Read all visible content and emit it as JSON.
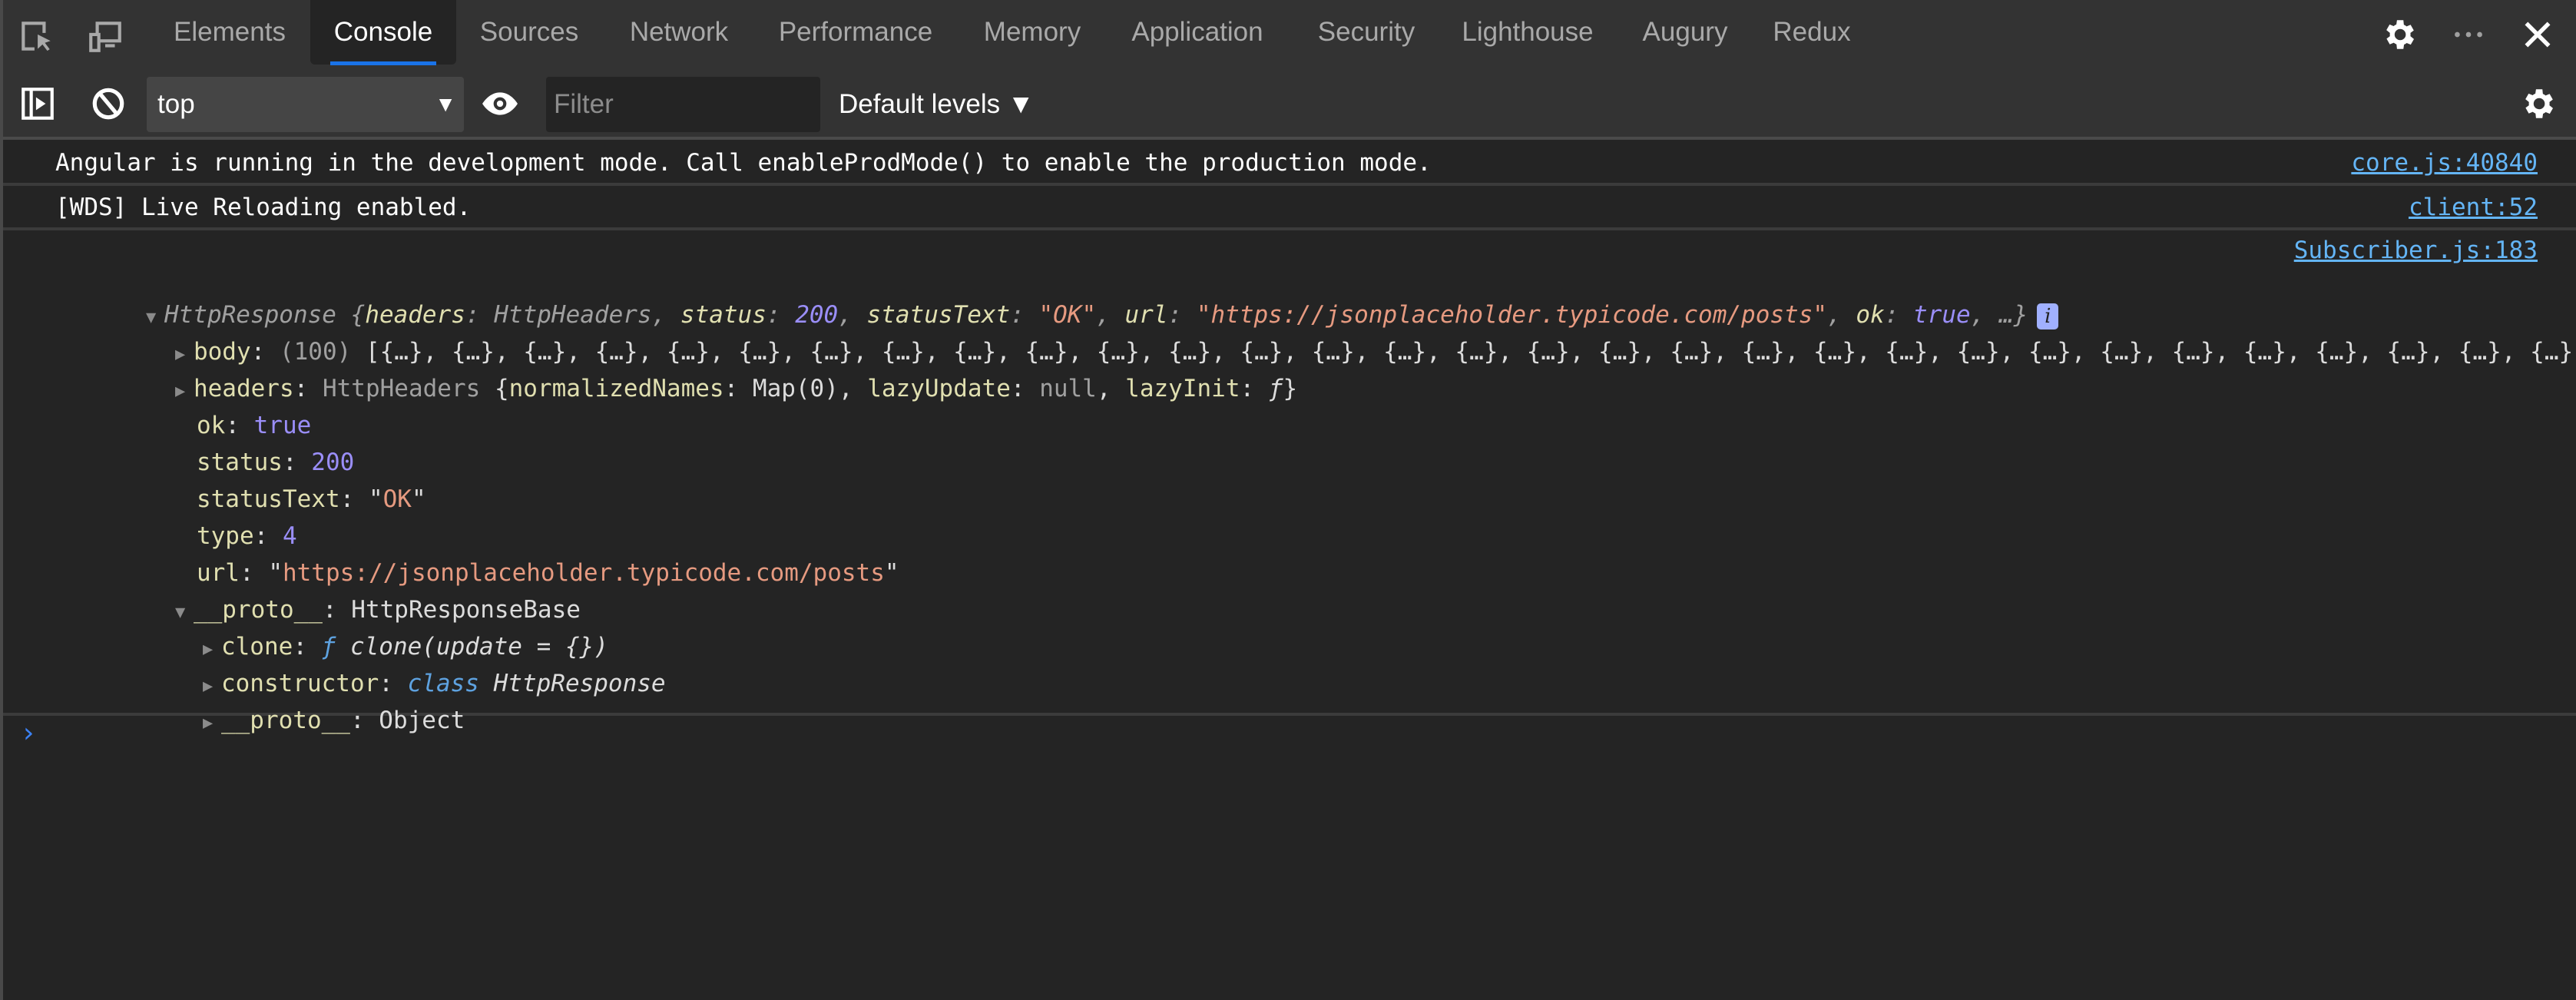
{
  "tabs": [
    {
      "label": "Elements",
      "active": false
    },
    {
      "label": "Console",
      "active": true
    },
    {
      "label": "Sources",
      "active": false
    },
    {
      "label": "Network",
      "active": false
    },
    {
      "label": "Performance",
      "active": false
    },
    {
      "label": "Memory",
      "active": false
    },
    {
      "label": "Application",
      "active": false
    },
    {
      "label": "Security",
      "active": false
    },
    {
      "label": "Lighthouse",
      "active": false
    },
    {
      "label": "Augury",
      "active": false
    },
    {
      "label": "Redux",
      "active": false
    }
  ],
  "toolbar": {
    "context_value": "top",
    "context_arrow": "▼",
    "filter_placeholder": "Filter",
    "filter_value": "",
    "levels_label": "Default levels ▼"
  },
  "messages": [
    {
      "text": "Angular is running in the development mode. Call enableProdMode() to enable the production mode.",
      "source": "core.js:40840"
    },
    {
      "text": "[WDS] Live Reloading enabled.",
      "source": "client:52"
    }
  ],
  "log": {
    "source": "Subscriber.js:183",
    "summary": {
      "class": "HttpResponse",
      "open": " {",
      "headers_key": "headers",
      "headers_val": "HttpHeaders",
      "status_key": "status",
      "status_val": "200",
      "statusText_key": "statusText",
      "statusText_val": "\"OK\"",
      "url_key": "url",
      "url_val": "\"https://jsonplaceholder.typicode.com/posts\"",
      "ok_key": "ok",
      "ok_val": "true",
      "tail": ", …}"
    },
    "body": {
      "key": "body",
      "count": "(100)",
      "preview": "[{…}, {…}, {…}, {…}, {…}, {…}, {…}, {…}, {…}, {…}, {…}, {…}, {…}, {…}, {…}, {…}, {…}, {…}, {…}, {…}, {…}, {…}, {…}, {…}, {…}, {…}, {…}, {…}, {…}, {…}, {…}, {…},…"
    },
    "headers": {
      "key": "headers",
      "class": "HttpHeaders",
      "open": " {",
      "k1": "normalizedNames",
      "v1": "Map(0)",
      "k2": "lazyUpdate",
      "v2": "null",
      "k3": "lazyInit",
      "v3": "ƒ",
      "close": "}"
    },
    "ok": {
      "key": "ok",
      "value": "true"
    },
    "status": {
      "key": "status",
      "value": "200"
    },
    "statusText": {
      "key": "statusText",
      "q1": "\"",
      "value": "OK",
      "q2": "\""
    },
    "type": {
      "key": "type",
      "value": "4"
    },
    "url": {
      "key": "url",
      "q1": "\"",
      "value": "https://jsonplaceholder.typicode.com/posts",
      "q2": "\""
    },
    "proto": {
      "key": "__proto__",
      "value": "HttpResponseBase"
    },
    "clone": {
      "key": "clone",
      "f": "ƒ",
      "sig": "clone(update = {})"
    },
    "constructor": {
      "key": "constructor",
      "kw": "class",
      "name": "HttpResponse"
    },
    "proto2": {
      "key": "__proto__",
      "value": "Object"
    }
  },
  "prompt": "›"
}
